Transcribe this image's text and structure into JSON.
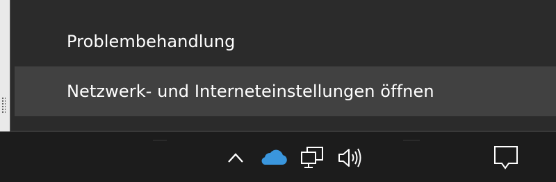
{
  "context_menu": {
    "items": [
      {
        "label": "Problembehandlung",
        "hovered": false
      },
      {
        "label": "Netzwerk- und Interneteinstellungen öffnen",
        "hovered": true
      }
    ]
  },
  "system_tray": {
    "icons": [
      "show-hidden-icons-chevron-up-icon",
      "onedrive-cloud-icon",
      "network-wired-icon",
      "speaker-volume-icon",
      "action-center-notification-icon"
    ]
  },
  "colors": {
    "menu_background": "#2b2b2b",
    "menu_hover": "#414141",
    "taskbar_background": "#1c1c1c",
    "onedrive_blue": "#3a96dd",
    "text": "#ffffff"
  }
}
